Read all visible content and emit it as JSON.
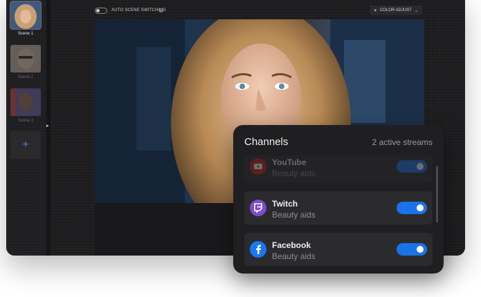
{
  "sidebar": {
    "scenes": [
      {
        "label": "Scene 1",
        "active": true
      },
      {
        "label": "Scene 2",
        "active": false
      },
      {
        "label": "Scene 3",
        "active": false
      }
    ],
    "add_icon": "+"
  },
  "topbar": {
    "auto_scene_label": "AUTO SCENE SWITCHING",
    "color_adjust_label": "COLOR ADJUST"
  },
  "controls": {
    "icons": [
      "volume-icon",
      "camera-icon"
    ]
  },
  "channels": {
    "title": "Channels",
    "active_count": "2 active streams",
    "items": [
      {
        "name": "YouTube",
        "subtitle": "Beauty aids",
        "color": "#cc1f1f",
        "enabled": true
      },
      {
        "name": "Twitch",
        "subtitle": "Beauty aids",
        "color": "#7b4bd6",
        "enabled": true
      },
      {
        "name": "Facebook",
        "subtitle": "Beauty aids",
        "color": "#1877f2",
        "enabled": true
      }
    ]
  },
  "colors": {
    "accent": "#1a73e8"
  }
}
